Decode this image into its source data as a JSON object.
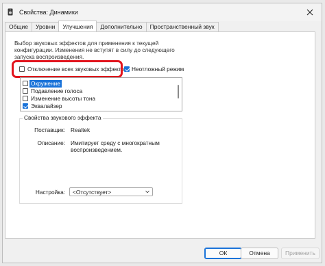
{
  "window": {
    "title": "Свойства: Динамики",
    "icon": "speaker-icon",
    "close_icon": "close-icon"
  },
  "tabs": [
    {
      "label": "Общие",
      "active": false
    },
    {
      "label": "Уровни",
      "active": false
    },
    {
      "label": "Улучшения",
      "active": true
    },
    {
      "label": "Дополнительно",
      "active": false
    },
    {
      "label": "Пространственный звук",
      "active": false
    }
  ],
  "enhancements": {
    "description": [
      "Выбор звуковых эффектов для применения к текущей",
      "конфигурации. Изменения не вступят в силу до следующего",
      "запуска воспроизведения."
    ],
    "disable_all": {
      "label": "Отключение всех звуковых эффектов",
      "checked": false
    },
    "immediate": {
      "label": "Неотложный режим",
      "checked": true
    },
    "effects": [
      {
        "label": "Окружение",
        "checked": false,
        "selected": true
      },
      {
        "label": "Подавление голоса",
        "checked": false,
        "selected": false
      },
      {
        "label": "Изменение высоты тона",
        "checked": false,
        "selected": false
      },
      {
        "label": "Эквалайзер",
        "checked": true,
        "selected": false
      }
    ]
  },
  "effect_properties": {
    "title": "Свойства звукового эффекта",
    "vendor_label": "Поставщик:",
    "vendor_value": "Realtek",
    "description_label": "Описание:",
    "description_value": [
      "Имитирует среду с многократным",
      "воспроизведением."
    ],
    "setting_label": "Настройка:",
    "setting_value": "<Отсутствует>"
  },
  "buttons": {
    "ok": "ОК",
    "cancel": "Отмена",
    "apply": "Применить"
  },
  "colors": {
    "accent": "#1a73d9",
    "highlight": "#e2141d"
  }
}
